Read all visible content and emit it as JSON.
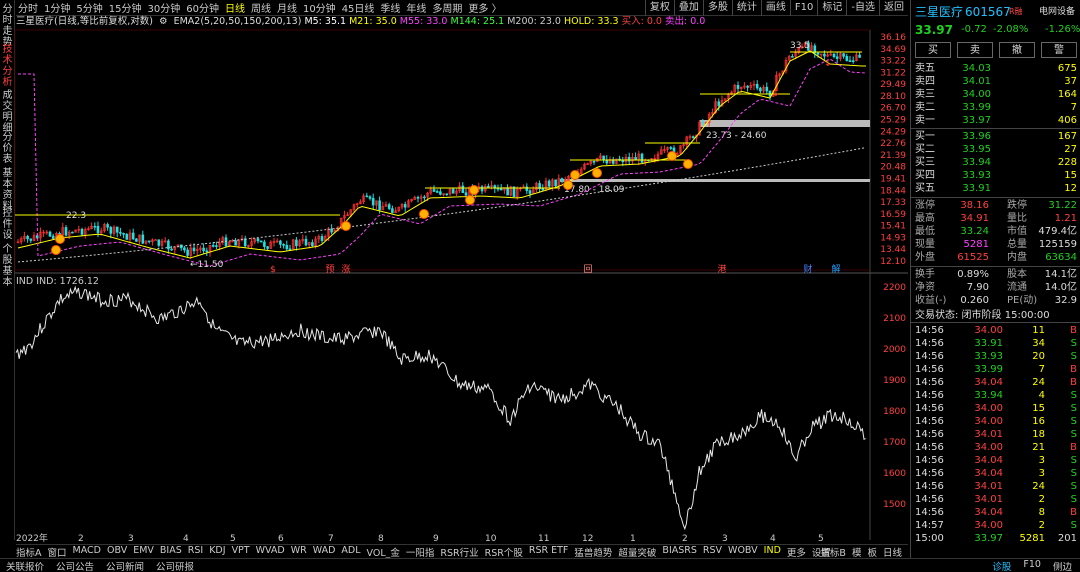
{
  "vtabs": [
    "分时走势",
    "技术分析",
    "成交明细",
    "分价表",
    "基本资料",
    "控件设",
    "个股基本"
  ],
  "period_tabs": [
    "分时",
    "1分钟",
    "5分钟",
    "15分钟",
    "30分钟",
    "60分钟",
    "日线",
    "周线",
    "月线",
    "10分钟",
    "45日线",
    "季线",
    "年线",
    "多周期",
    "更多 〉"
  ],
  "active_period": "日线",
  "right_tools": [
    "复权",
    "叠加",
    "多股",
    "统计",
    "画线",
    "F10",
    "标记",
    "-自选",
    "返回"
  ],
  "infobar": {
    "title": "三星医疗(日线,等比前复权,对数)",
    "ema": "EMA2(5,20,50,150,200,13)",
    "m5": "M5: 35.1",
    "m21": "M21: 35.0",
    "m55": "M55: 33.0",
    "m144": "M144: 25.1",
    "m200": "M200: 23.0",
    "hold": "HOLD: 33.3",
    "buy": "买入: 0.0",
    "sell": "卖出: 0.0"
  },
  "price_axis": [
    "36.16",
    "34.69",
    "33.22",
    "31.22",
    "29.49",
    "28.10",
    "26.70",
    "25.29",
    "24.29",
    "22.76",
    "21.39",
    "20.48",
    "19.41",
    "18.44",
    "17.33",
    "16.59",
    "15.41",
    "14.93",
    "13.44",
    "12.10"
  ],
  "chart_labels": {
    "hi": "33.5",
    "lo": "←11.50",
    "l1": "22.3",
    "z1": "23.73 - 24.60",
    "z2": "17.80 - 18.09"
  },
  "markers": [
    {
      "t": "$",
      "c": "#ff4040"
    },
    {
      "t": "预",
      "c": "#ff4040"
    },
    {
      "t": "涨",
      "c": "#ff4040"
    },
    {
      "t": "回",
      "c": "#ff8080"
    },
    {
      "t": "港",
      "c": "#ff4040"
    },
    {
      "t": "财",
      "c": "#4080ff"
    },
    {
      "t": "解",
      "c": "#20a0ff"
    }
  ],
  "indicator": {
    "header": "IND  IND: 1726.12",
    "axis": [
      "2200",
      "2100",
      "2000",
      "1900",
      "1800",
      "1700",
      "1600",
      "1500"
    ]
  },
  "x_axis": [
    "2022年",
    "2",
    "3",
    "4",
    "5",
    "6",
    "7",
    "8",
    "9",
    "10",
    "11",
    "12",
    "1",
    "2",
    "3",
    "4",
    "5"
  ],
  "bottom_tabs": [
    "指标A",
    "窗口",
    "MACD",
    "OBV",
    "EMV",
    "BIAS",
    "RSI",
    "KDJ",
    "VPT",
    "WVAD",
    "WR",
    "WAD",
    "ADL",
    "VOL_金",
    "一阳指",
    "RSR行业",
    "RSR个股",
    "RSR ETF",
    "猛兽趋势",
    "超量突破",
    "BIASRS",
    "RSV",
    "WOBV",
    "IND",
    "更多",
    "设置"
  ],
  "active_bottom_tab": "IND",
  "bottom_right": [
    "指标B",
    "模",
    "板",
    "日线"
  ],
  "statusbar": [
    "关联报价",
    "公司公告",
    "公司新闻",
    "公司研报"
  ],
  "statusbar_right": [
    "诊股",
    "F10",
    "侧边"
  ],
  "stock": {
    "name": "三星医疗",
    "code": "601567",
    "tag": "R融",
    "sector": "电网设备",
    "price": "33.97",
    "chg": "-0.72",
    "pct": "-2.08%",
    "sector_pct": "-1.26%"
  },
  "trade_buttons": [
    "买",
    "卖",
    "撤",
    "警"
  ],
  "asks": [
    {
      "label": "卖五",
      "price": "34.03",
      "vol": "675"
    },
    {
      "label": "卖四",
      "price": "34.01",
      "vol": "37"
    },
    {
      "label": "卖三",
      "price": "34.00",
      "vol": "164"
    },
    {
      "label": "卖二",
      "price": "33.99",
      "vol": "7"
    },
    {
      "label": "卖一",
      "price": "33.97",
      "vol": "406"
    }
  ],
  "bids": [
    {
      "label": "买一",
      "price": "33.96",
      "vol": "167"
    },
    {
      "label": "买二",
      "price": "33.95",
      "vol": "27"
    },
    {
      "label": "买三",
      "price": "33.94",
      "vol": "228"
    },
    {
      "label": "买四",
      "price": "33.93",
      "vol": "15"
    },
    {
      "label": "买五",
      "price": "33.91",
      "vol": "12"
    }
  ],
  "stats": [
    [
      "涨停",
      "38.16",
      "跌停",
      "31.22"
    ],
    [
      "最高",
      "34.91",
      "量比",
      "1.21"
    ],
    [
      "最低",
      "33.24",
      "市值",
      "479.4亿"
    ],
    [
      "现量",
      "5281",
      "总量",
      "125159"
    ],
    [
      "外盘",
      "61525",
      "内盘",
      "63634"
    ]
  ],
  "stats2": [
    [
      "换手",
      "0.89%",
      "股本",
      "14.1亿"
    ],
    [
      "净资",
      "7.90",
      "流通",
      "14.0亿"
    ],
    [
      "收益(-)",
      "0.260",
      "PE(动)",
      "32.9"
    ]
  ],
  "trade_state": "交易状态: 闭市阶段 15:00:00",
  "ticks": [
    [
      "14:56",
      "34.00",
      "11",
      "B"
    ],
    [
      "14:56",
      "33.91",
      "34",
      "S"
    ],
    [
      "14:56",
      "33.93",
      "20",
      "S"
    ],
    [
      "14:56",
      "33.99",
      "7",
      "B"
    ],
    [
      "14:56",
      "34.04",
      "24",
      "B"
    ],
    [
      "14:56",
      "33.94",
      "4",
      "S"
    ],
    [
      "14:56",
      "34.00",
      "15",
      "S"
    ],
    [
      "14:56",
      "34.00",
      "16",
      "S"
    ],
    [
      "14:56",
      "34.01",
      "18",
      "S"
    ],
    [
      "14:56",
      "34.00",
      "21",
      "B"
    ],
    [
      "14:56",
      "34.04",
      "3",
      "S"
    ],
    [
      "14:56",
      "34.04",
      "3",
      "S"
    ],
    [
      "14:56",
      "34.01",
      "24",
      "S"
    ],
    [
      "14:56",
      "34.01",
      "2",
      "S"
    ],
    [
      "14:56",
      "34.04",
      "8",
      "B"
    ],
    [
      "14:57",
      "34.00",
      "2",
      "S"
    ],
    [
      "15:00",
      "33.97",
      "5281",
      "201"
    ]
  ]
}
